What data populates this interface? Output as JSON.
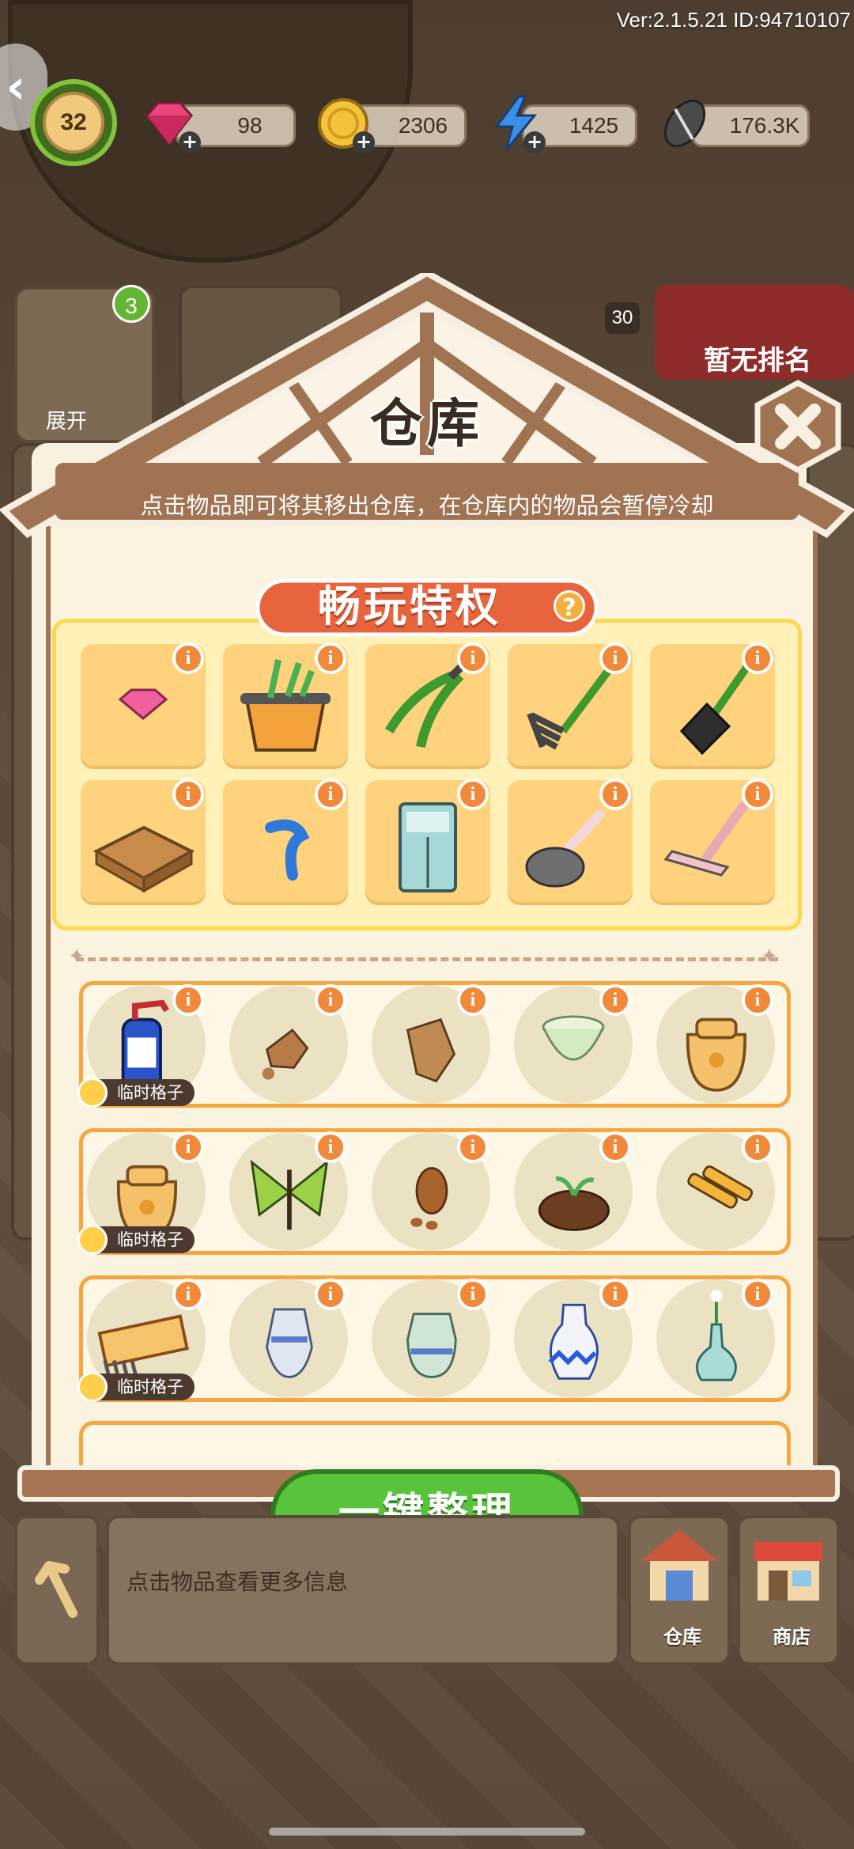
{
  "hud": {
    "version": "Ver:2.1.5.21 ID:94710107",
    "level": "32",
    "gems": "98",
    "coins": "2306",
    "energy": "1425",
    "seeds": "176.3K"
  },
  "background": {
    "expand_label": "展开",
    "badge_count": "3",
    "rank_label": "暂无排名",
    "item_count": "30"
  },
  "modal": {
    "title": "仓库",
    "subtitle": "点击物品即可将其移出仓库，在仓库内的物品会暂停冷却",
    "privilege_title": "畅玩特权",
    "privilege_help": "?",
    "info_glyph": "i",
    "temp_slot_label": "临时格子",
    "organize_button": "一键整理"
  },
  "privilege_items": [
    {
      "name": "pink-gem"
    },
    {
      "name": "plant-pot"
    },
    {
      "name": "pruning-shears"
    },
    {
      "name": "garden-fork"
    },
    {
      "name": "shovel"
    },
    {
      "name": "wooden-crate"
    },
    {
      "name": "blue-hook"
    },
    {
      "name": "blue-cabinet"
    },
    {
      "name": "toilet-plunger"
    },
    {
      "name": "squeegee"
    }
  ],
  "storage_rows": [
    [
      "spray-bottle",
      "broken-shard",
      "clay-fragment",
      "celadon-bowl",
      "seed-sack"
    ],
    [
      "seed-sack",
      "green-butterfly",
      "pine-cone",
      "soil-sprout",
      "syringe-tools"
    ],
    [
      "comb-box",
      "cracked-vase",
      "jade-jar",
      "blue-white-vase",
      "flower-vase"
    ]
  ],
  "bottom": {
    "info_hint": "点击物品查看更多信息",
    "warehouse_label": "仓库",
    "shop_label": "商店"
  },
  "colors": {
    "roof": "#a07352",
    "privilege_panel": "#fff1b8",
    "row_border": "#f5a640",
    "info_badge": "#f0893a",
    "organize_green": "#57c43b"
  }
}
